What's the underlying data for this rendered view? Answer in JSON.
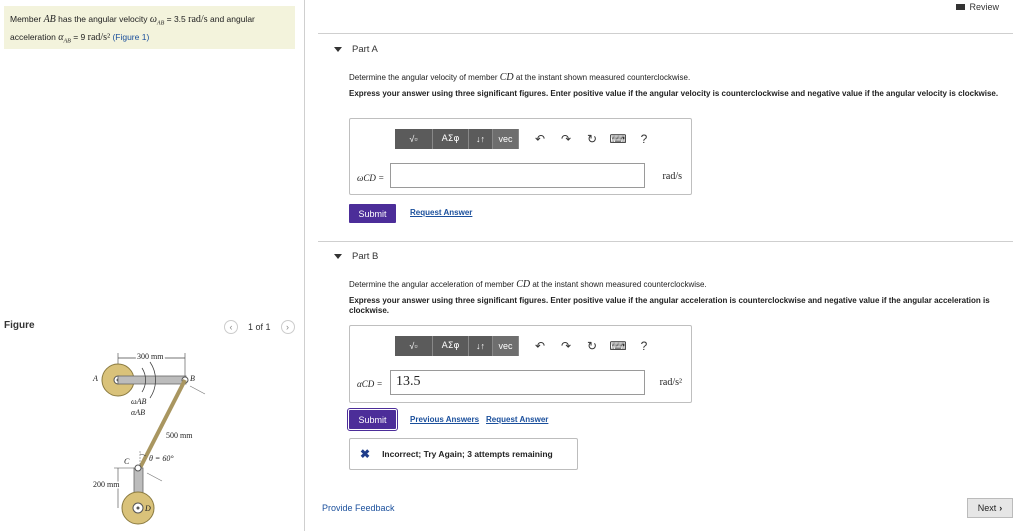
{
  "problem": {
    "text_prefix": "Member",
    "member": "AB",
    "text_mid1": "has the angular velocity",
    "omega_symbol": "ω",
    "omega_sub": "AB",
    "omega_value": "= 3.5",
    "omega_unit": "rad/s",
    "text_mid2": "and angular",
    "line2_prefix": "acceleration",
    "alpha_symbol": "α",
    "alpha_sub": "AB",
    "alpha_value": "= 9",
    "alpha_unit": "rad/s²",
    "figure_link": "(Figure 1)"
  },
  "review": "Review",
  "partA": {
    "title": "Part A",
    "prompt_prefix": "Determine the angular velocity of member",
    "prompt_member": "CD",
    "prompt_suffix": "at the instant shown measured counterclockwise.",
    "instruction": "Express your answer using three significant figures. Enter positive value if the angular velocity is counterclockwise and negative value if the angular velocity is clockwise.",
    "var_label": "ωCD =",
    "input_value": "",
    "unit": "rad/s",
    "submit": "Submit",
    "request_answer": "Request Answer"
  },
  "partB": {
    "title": "Part B",
    "prompt_prefix": "Determine the angular acceleration of member",
    "prompt_member": "CD",
    "prompt_suffix": "at the instant shown measured counterclockwise.",
    "instruction": "Express your answer using three significant figures. Enter positive value if the angular acceleration is counterclockwise and negative value if the angular acceleration is clockwise.",
    "var_label": "αCD =",
    "input_value": "13.5",
    "unit": "rad/s²",
    "submit": "Submit",
    "previous_answers": "Previous Answers",
    "request_answer": "Request Answer",
    "feedback": "Incorrect; Try Again; 3 attempts remaining"
  },
  "toolbar": {
    "templates": "√▫",
    "greek": "ΑΣφ",
    "arrows": "↓↑",
    "vec": "vec",
    "undo": "↶",
    "redo": "↷",
    "reset": "↻",
    "keyboard": "⌨",
    "help": "?"
  },
  "figure": {
    "label": "Figure",
    "pager": "1 of 1",
    "dim_300": "300 mm",
    "dim_500": "500 mm",
    "dim_200": "200 mm",
    "angle": "θ = 60°",
    "pt_A": "A",
    "pt_B": "B",
    "pt_C": "C",
    "pt_D": "D",
    "omega_label": "ωAB",
    "alpha_label": "αAB"
  },
  "footer": {
    "provide_feedback": "Provide Feedback",
    "next": "Next"
  }
}
